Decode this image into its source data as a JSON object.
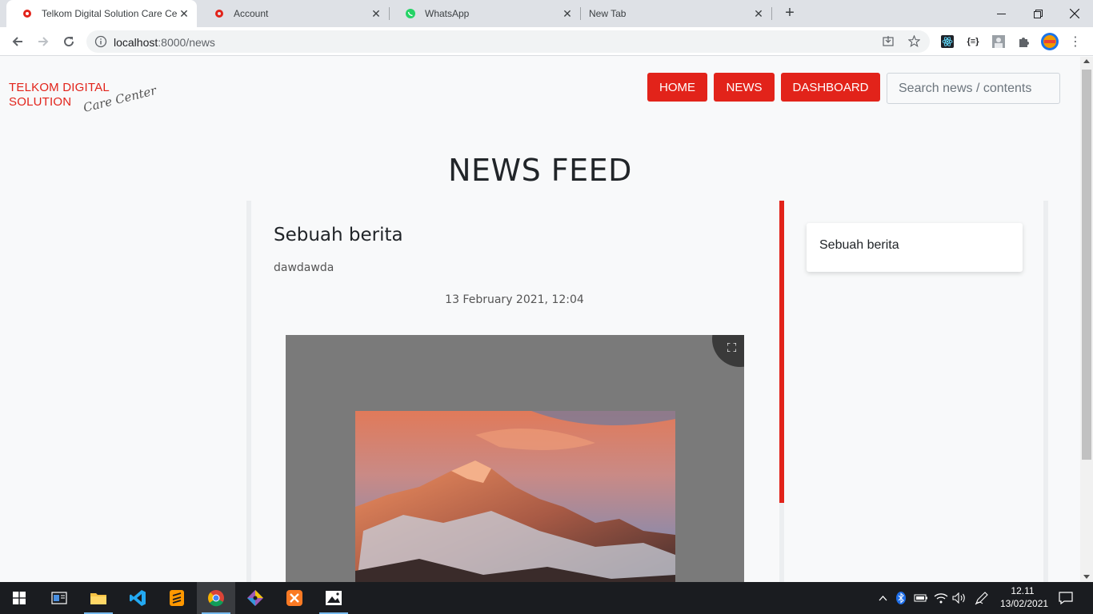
{
  "browser": {
    "tabs": [
      {
        "title": "Telkom Digital Solution Care Cen",
        "favicon": "telkom-favicon",
        "active": true
      },
      {
        "title": "Account",
        "favicon": "telkom-favicon",
        "active": false
      },
      {
        "title": "WhatsApp",
        "favicon": "whatsapp-icon",
        "active": false
      },
      {
        "title": "New Tab",
        "favicon": "",
        "active": false
      }
    ],
    "new_tab": "+",
    "url_host": "localhost",
    "url_path": ":8000/news",
    "window_controls": {
      "minimize": "—",
      "restore": "❐",
      "close": "✕"
    }
  },
  "site": {
    "logo_line1": "TELKOM DIGITAL",
    "logo_line2": "SOLUTION",
    "logo_script": "Care Center",
    "nav": {
      "home": "HOME",
      "news": "NEWS",
      "dashboard": "DASHBOARD"
    },
    "search_placeholder": "Search news / contents",
    "page_title": "NEWS FEED"
  },
  "news": {
    "title": "Sebuah berita",
    "body": "dawdawda",
    "date": "13 February 2021, 12:04"
  },
  "sidebar": {
    "items": [
      {
        "label": "Sebuah berita"
      }
    ]
  },
  "colors": {
    "brand_red": "#e2231a",
    "text_dark": "#212529"
  },
  "taskbar": {
    "apps": [
      "start-icon",
      "task-view-icon",
      "file-explorer-icon",
      "vscode-icon",
      "sublime-icon",
      "chrome-icon",
      "git-icon",
      "xampp-icon",
      "photos-icon"
    ],
    "time": "12.11",
    "date": "13/02/2021"
  }
}
